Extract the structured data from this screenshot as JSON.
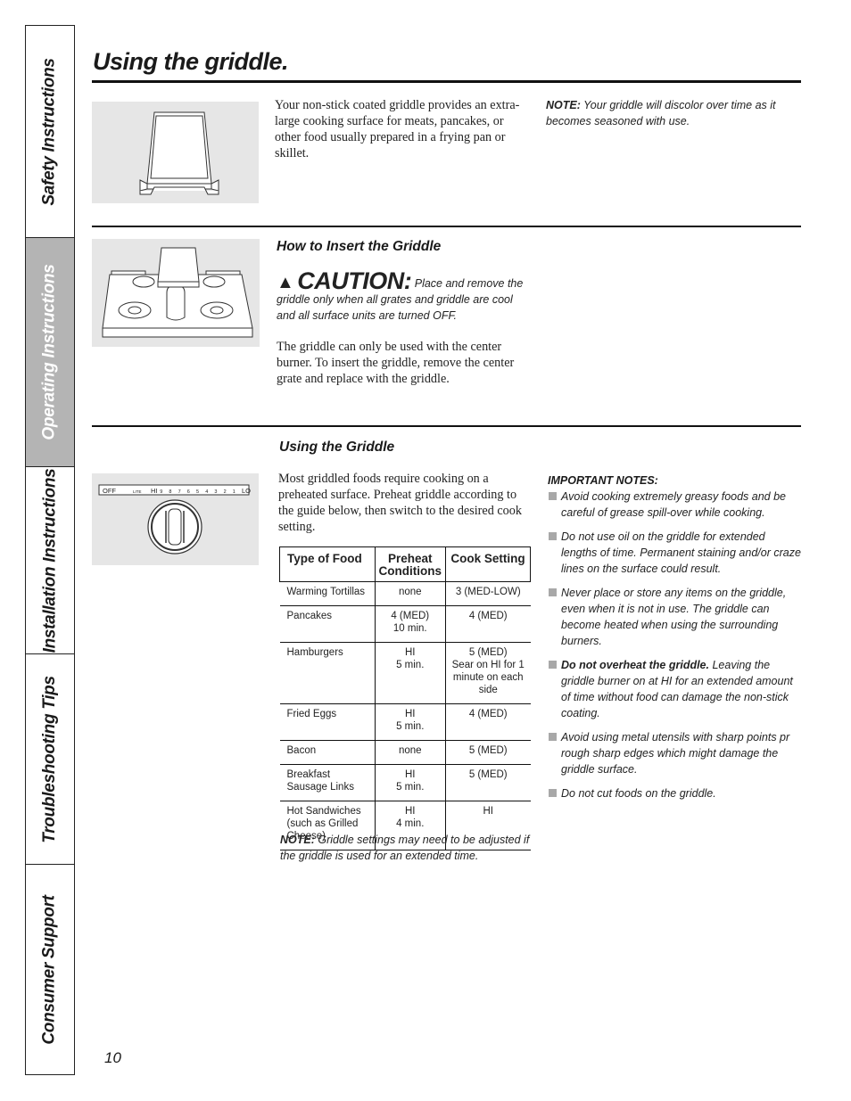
{
  "sidebar": {
    "tabs": [
      {
        "label": "Safety Instructions",
        "active": false
      },
      {
        "label": "Operating Instructions",
        "active": true
      },
      {
        "label": "Installation Instructions",
        "active": false
      },
      {
        "label": "Troubleshooting Tips",
        "active": false
      },
      {
        "label": "Consumer Support",
        "active": false
      }
    ]
  },
  "page": {
    "title": "Using the griddle.",
    "page_number": "10"
  },
  "intro": {
    "text": "Your non-stick coated griddle provides an extra-large cooking surface for meats, pancakes, or other food usually prepared in a frying pan or skillet.",
    "note_label": "NOTE:",
    "note_text": " Your griddle will discolor over time as it becomes seasoned with use."
  },
  "insert": {
    "heading": "How to Insert the Griddle",
    "caution_word": "CAUTION:",
    "caution_text": " Place and remove the griddle only when all grates and griddle are cool and all surface units are turned OFF.",
    "body": "The griddle can only be used with the center burner. To insert the griddle, remove the center grate and replace with the griddle."
  },
  "using": {
    "heading": "Using the Griddle",
    "body": "Most griddled foods require cooking on a preheated surface. Preheat griddle according to the guide below, then switch to the desired cook setting.",
    "knob_scale": {
      "off": "OFF",
      "lite": "LITE",
      "marks": [
        "HI",
        "9",
        "8",
        "7",
        "6",
        "5",
        "4",
        "3",
        "2",
        "1",
        "LO"
      ]
    },
    "table": {
      "headers": [
        "Type of Food",
        "Preheat Conditions",
        "Cook Setting"
      ],
      "rows": [
        {
          "food": "Warming Tortillas",
          "preheat": "none",
          "cook": "3 (MED-LOW)"
        },
        {
          "food": "Pancakes",
          "preheat": "4 (MED)\n10 min.",
          "cook": "4 (MED)"
        },
        {
          "food": "Hamburgers",
          "preheat": "HI\n5 min.",
          "cook": "5 (MED)\nSear on HI for 1 minute on each side"
        },
        {
          "food": "Fried Eggs",
          "preheat": "HI\n5 min.",
          "cook": "4 (MED)"
        },
        {
          "food": "Bacon",
          "preheat": "none",
          "cook": "5 (MED)"
        },
        {
          "food": "Breakfast Sausage Links",
          "preheat": "HI\n5 min.",
          "cook": "5 (MED)"
        },
        {
          "food": "Hot Sandwiches (such as Grilled Cheese)",
          "preheat": "HI\n4 min.",
          "cook": "HI"
        }
      ]
    },
    "table_note_label": "NOTE:",
    "table_note_text": " Griddle settings may need to be adjusted if the griddle is used for an extended time."
  },
  "important_notes": {
    "heading": "IMPORTANT NOTES:",
    "items": [
      {
        "bold": "",
        "text": "Avoid cooking extremely greasy foods and be careful of grease spill-over while cooking."
      },
      {
        "bold": "",
        "text": "Do not use oil on the griddle for extended lengths of time. Permanent staining and/or craze lines on the surface could result."
      },
      {
        "bold": "",
        "text": "Never place or store any items on the griddle, even when it is not in use. The griddle can become heated when using the surrounding burners."
      },
      {
        "bold": "Do not overheat the griddle.",
        "text": " Leaving the griddle burner on at HI for an extended amount of time without food can damage the non-stick coating."
      },
      {
        "bold": "",
        "text": "Avoid using metal utensils with sharp points pr rough sharp edges which might damage the griddle surface."
      },
      {
        "bold": "",
        "text": "Do not cut foods on the griddle."
      }
    ]
  }
}
